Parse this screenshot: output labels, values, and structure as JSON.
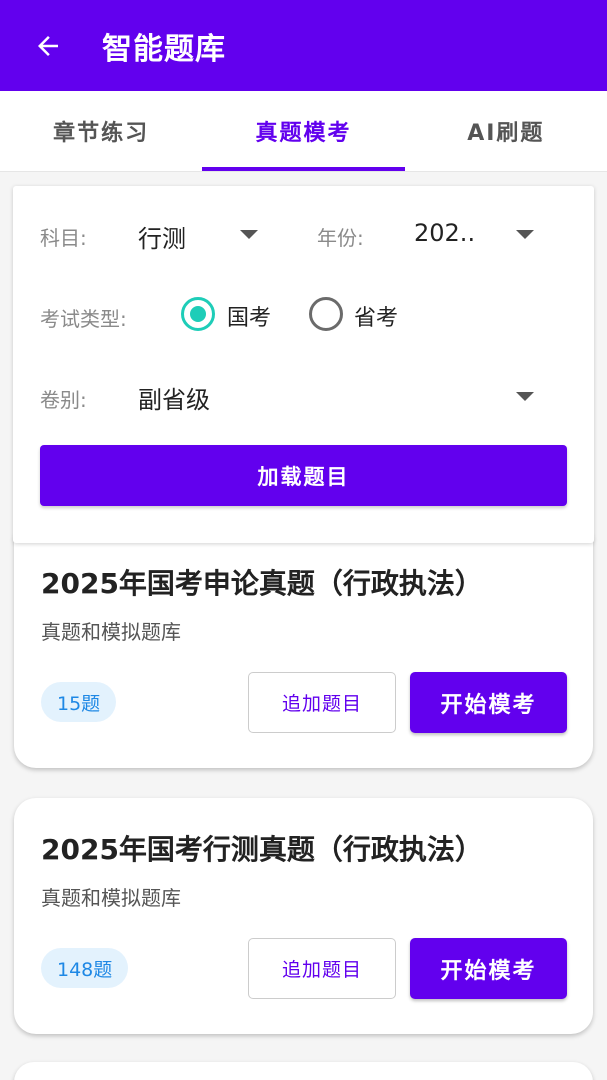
{
  "header": {
    "title": "智能题库",
    "back_icon": "arrow-left-icon"
  },
  "tabs": [
    {
      "label": "章节练习",
      "active": false
    },
    {
      "label": "真题模考",
      "active": true
    },
    {
      "label": "AI刷题",
      "active": false
    }
  ],
  "filter": {
    "subject_label": "科目:",
    "subject_value": "行测",
    "year_label": "年份:",
    "year_value": "202..",
    "exam_type_label": "考试类型:",
    "exam_types": [
      {
        "label": "国考",
        "checked": true
      },
      {
        "label": "省考",
        "checked": false
      }
    ],
    "paper_label": "卷别:",
    "paper_value": "副省级",
    "load_button": "加载题目"
  },
  "cards": [
    {
      "title": "2025年国考申论真题（行政执法）",
      "subtitle": "真题和模拟题库",
      "count": "15题",
      "add_button": "追加题目",
      "start_button": "开始模考"
    },
    {
      "title": "2025年国考行测真题（行政执法）",
      "subtitle": "真题和模拟题库",
      "count": "148题",
      "add_button": "追加题目",
      "start_button": "开始模考"
    }
  ],
  "colors": {
    "primary": "#6200ee",
    "radio_checked": "#1ecdb8",
    "badge_bg": "#e3f2fd",
    "badge_text": "#1e88e5"
  }
}
